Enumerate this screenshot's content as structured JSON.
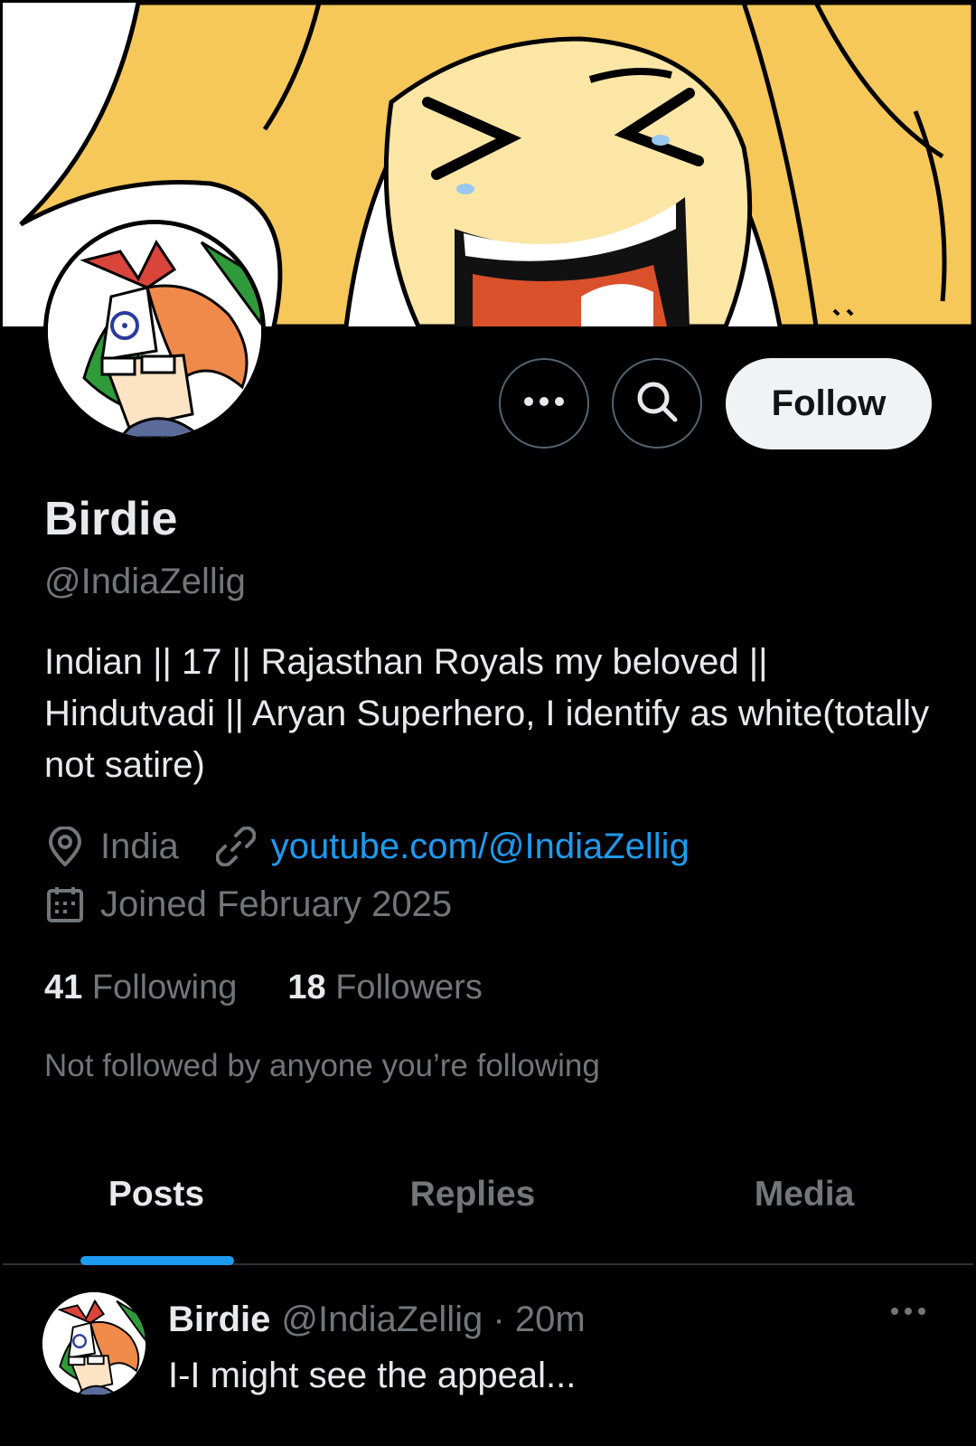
{
  "profile": {
    "display_name": "Birdie",
    "handle": "@IndiaZellig",
    "bio": "Indian || 17 || Rajasthan Royals my beloved || Hindutvadi || Aryan Superhero, I identify as white(totally not satire)",
    "location": "India",
    "link": "youtube.com/@IndiaZellig",
    "joined": "Joined February 2025",
    "following_count": "41",
    "following_label": "Following",
    "followers_count": "18",
    "followers_label": "Followers",
    "mutuals_note": "Not followed by anyone you’re following"
  },
  "actions": {
    "follow_label": "Follow",
    "more_icon": "more-horizontal-icon",
    "search_icon": "search-icon"
  },
  "tabs": [
    {
      "label": "Posts",
      "active": true
    },
    {
      "label": "Replies",
      "active": false
    },
    {
      "label": "Media",
      "active": false
    }
  ],
  "post": {
    "author_name": "Birdie",
    "author_handle": "@IndiaZellig",
    "separator": "·",
    "time": "20m",
    "text": "I-I might see the appeal..."
  },
  "colors": {
    "background": "#000000",
    "text_primary": "#e7e9ea",
    "text_secondary": "#71767b",
    "accent": "#1d9bf0",
    "follow_button_bg": "#eff3f4"
  }
}
